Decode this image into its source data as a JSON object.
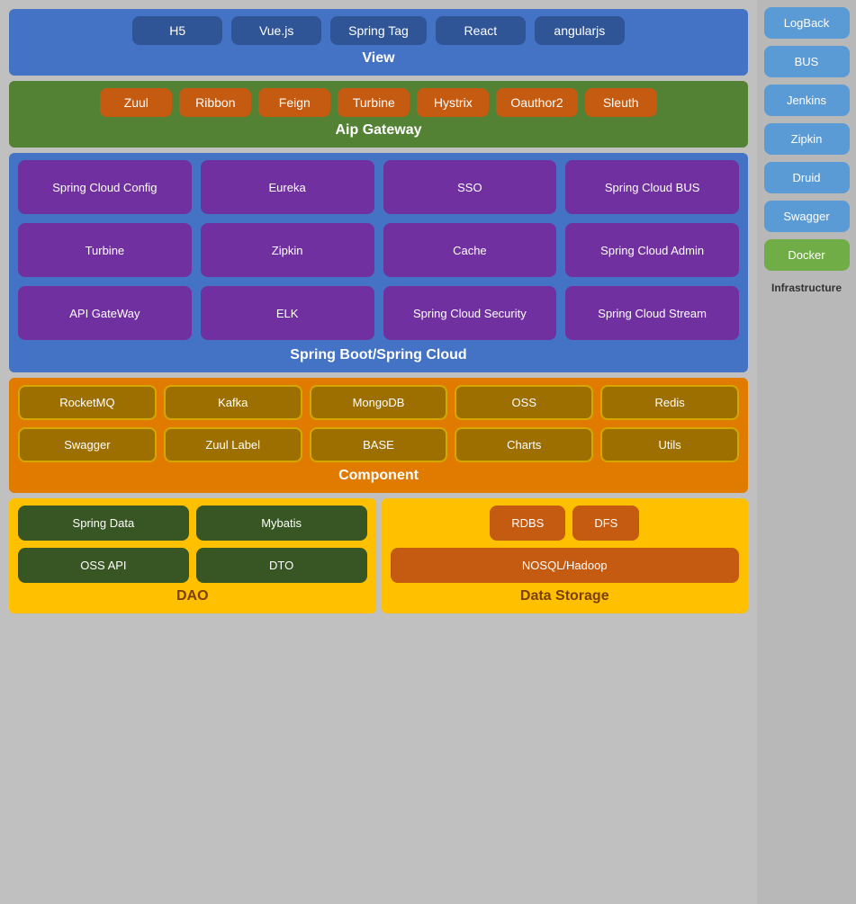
{
  "view": {
    "label": "View",
    "items": [
      "H5",
      "Vue.js",
      "Spring Tag",
      "React",
      "angularjs"
    ]
  },
  "gateway": {
    "label": "Aip Gateway",
    "items": [
      "Zuul",
      "Ribbon",
      "Feign",
      "Turbine",
      "Hystrix",
      "Oauthor2",
      "Sleuth"
    ]
  },
  "springboot": {
    "label": "Spring Boot/Spring Cloud",
    "items": [
      "Spring Cloud Config",
      "Eureka",
      "SSO",
      "Spring Cloud BUS",
      "Turbine",
      "Zipkin",
      "Cache",
      "Spring Cloud Admin",
      "API GateWay",
      "ELK",
      "Spring Cloud Security",
      "Spring Cloud Stream"
    ]
  },
  "component": {
    "label": "Component",
    "row1": [
      "RocketMQ",
      "Kafka",
      "MongoDB",
      "OSS",
      "Redis"
    ],
    "row2": [
      "Swagger",
      "Zuul Label",
      "BASE",
      "Charts",
      "Utils"
    ]
  },
  "dao": {
    "label": "DAO",
    "items": [
      "Spring Data",
      "Mybatis",
      "OSS API",
      "DTO"
    ]
  },
  "datastorage": {
    "label": "Data Storage",
    "top": [
      "RDBS",
      "DFS"
    ],
    "full": "NOSQL/Hadoop"
  },
  "sidebar": {
    "items": [
      "LogBack",
      "BUS",
      "Jenkins",
      "Zipkin",
      "Druid",
      "Swagger",
      "Docker"
    ],
    "infrastructure_label": "Infrastructure"
  }
}
